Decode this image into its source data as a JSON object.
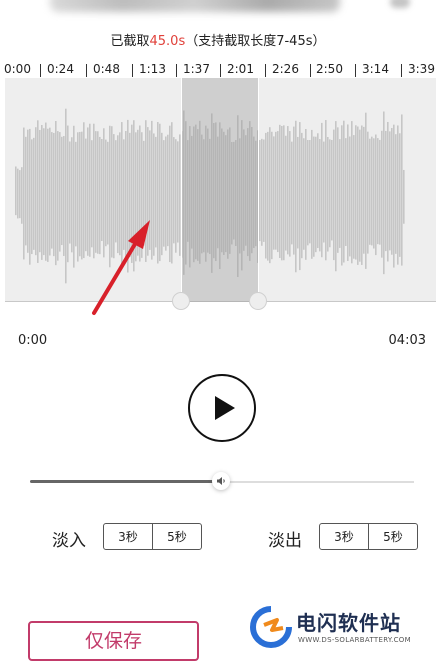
{
  "header": {
    "clip_prefix": "已截取",
    "clip_value": "45.0s",
    "clip_suffix": "（支持截取长度7-45s）"
  },
  "timeline": {
    "labels": [
      "0:00",
      "0:24",
      "0:48",
      "1:13",
      "1:37",
      "2:01",
      "2:26",
      "2:50",
      "3:14",
      "3:39"
    ]
  },
  "waveform": {
    "selection_start": "1:37",
    "selection_end": "2:01"
  },
  "playback": {
    "start_time": "0:00",
    "end_time": "04:03"
  },
  "volume": {
    "level_fraction": 0.48
  },
  "fade": {
    "in_label": "淡入",
    "out_label": "淡出",
    "in_options": [
      "3秒",
      "5秒"
    ],
    "out_options": [
      "3秒",
      "5秒"
    ]
  },
  "actions": {
    "save_only_label": "仅保存"
  },
  "watermark": {
    "title": "电闪软件站",
    "subtitle": "WWW.DS-SOLARBATTERY.COM"
  },
  "colors": {
    "accent_red": "#e0413a",
    "save_pink": "#c23b6a",
    "annotation_arrow": "#d8202a"
  },
  "icons": {
    "play": "play-icon",
    "volume": "speaker-icon",
    "logo": "lightning-logo-icon"
  }
}
